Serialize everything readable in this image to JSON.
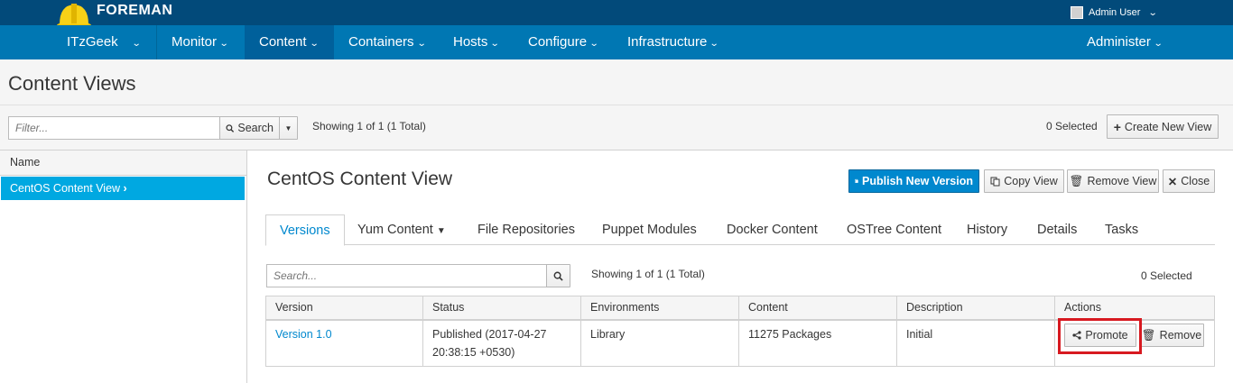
{
  "brand": {
    "name": "FOREMAN"
  },
  "user": {
    "name": "Admin User"
  },
  "nav": {
    "org": "ITzGeek",
    "items": [
      "Monitor",
      "Content",
      "Containers",
      "Hosts",
      "Configure",
      "Infrastructure"
    ],
    "right": "Administer"
  },
  "page": {
    "title": "Content Views"
  },
  "toolbar": {
    "filter_placeholder": "Filter...",
    "search_label": "Search",
    "showing": "Showing 1 of 1 (1 Total)",
    "selected": "0 Selected",
    "create_label": "Create New View"
  },
  "left": {
    "header": "Name",
    "item": "CentOS Content View"
  },
  "detail": {
    "title": "CentOS Content View",
    "publish": "Publish New Version",
    "copy": "Copy View",
    "remove": "Remove View",
    "close": "Close",
    "tabs": [
      "Versions",
      "Yum Content",
      "File Repositories",
      "Puppet Modules",
      "Docker Content",
      "OSTree Content",
      "History",
      "Details",
      "Tasks"
    ],
    "search_placeholder": "Search...",
    "showing": "Showing 1 of 1 (1 Total)",
    "selected": "0 Selected"
  },
  "table": {
    "headers": [
      "Version",
      "Status",
      "Environments",
      "Content",
      "Description",
      "Actions"
    ],
    "row": {
      "version": "Version 1.0",
      "status_line1": "Published (2017-04-27",
      "status_line2": "20:38:15 +0530)",
      "environments": "Library",
      "content": "11275 Packages",
      "description": "Initial",
      "promote": "Promote",
      "remove": "Remove"
    }
  },
  "colors": {
    "topbar": "#024a7a",
    "navbar": "#0077b3",
    "accent": "#0088ce",
    "selected": "#00a8e1",
    "highlight": "#d71920"
  }
}
